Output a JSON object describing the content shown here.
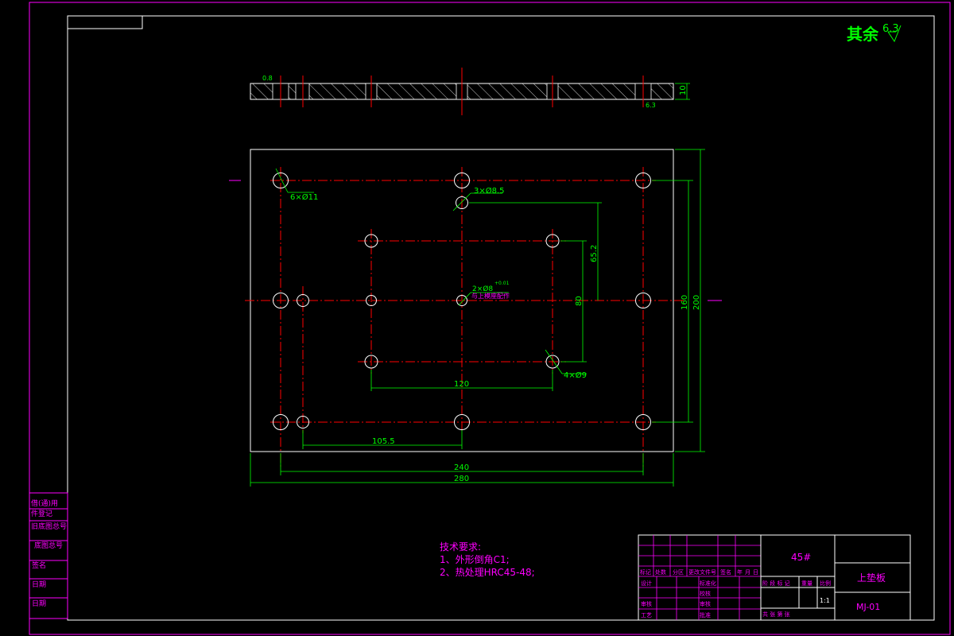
{
  "drawing": {
    "roughness_note": "其余",
    "roughness_value": "6.3",
    "side_view": {
      "thickness_dim": "10",
      "left_note": "0.8",
      "right_note": "6.3"
    },
    "dims": {
      "hole_6": "6×Ø11",
      "hole_3": "3×Ø8.5",
      "hole_2": "2×Ø8",
      "hole_2_tol": "+0.01",
      "hole_2_note": "与上模座配作",
      "hole_4": "4×Ø9",
      "d_65_2": "65.2",
      "d_80": "80",
      "d_160": "160",
      "d_200": "200",
      "d_120": "120",
      "d_105_5": "105.5",
      "d_240": "240",
      "d_280": "280"
    },
    "tech_req": {
      "title": "技术要求:",
      "line1": "1、外形倒角C1;",
      "line2": "2、热处理HRC45-48;"
    },
    "left_strip": [
      "借(通)用",
      "件登记",
      "旧底图总号",
      "底图总号",
      "签名",
      "日期",
      "日期"
    ],
    "title_block": {
      "material": "45#",
      "part_name": "上垫板",
      "drawing_no": "MJ-01",
      "scale": "1:1",
      "hdr_row": [
        "标记",
        "处数",
        "分区",
        "更改文件号",
        "签名",
        "年",
        "月",
        "日"
      ],
      "stage_labels": [
        "阶 段 标 记",
        "重量",
        "比例"
      ],
      "sheet_label": "共  张   第  张",
      "role_design": "设计",
      "role_std": "标准化",
      "role_check": "审核",
      "role_craft": "工艺",
      "role_approve": "批准",
      "role_review": "审核",
      "role_chk2": "校核"
    },
    "colors": {
      "magenta": "#ff00ff",
      "green": "#00ff00",
      "red": "#ff0000",
      "white": "#ffffff"
    }
  }
}
